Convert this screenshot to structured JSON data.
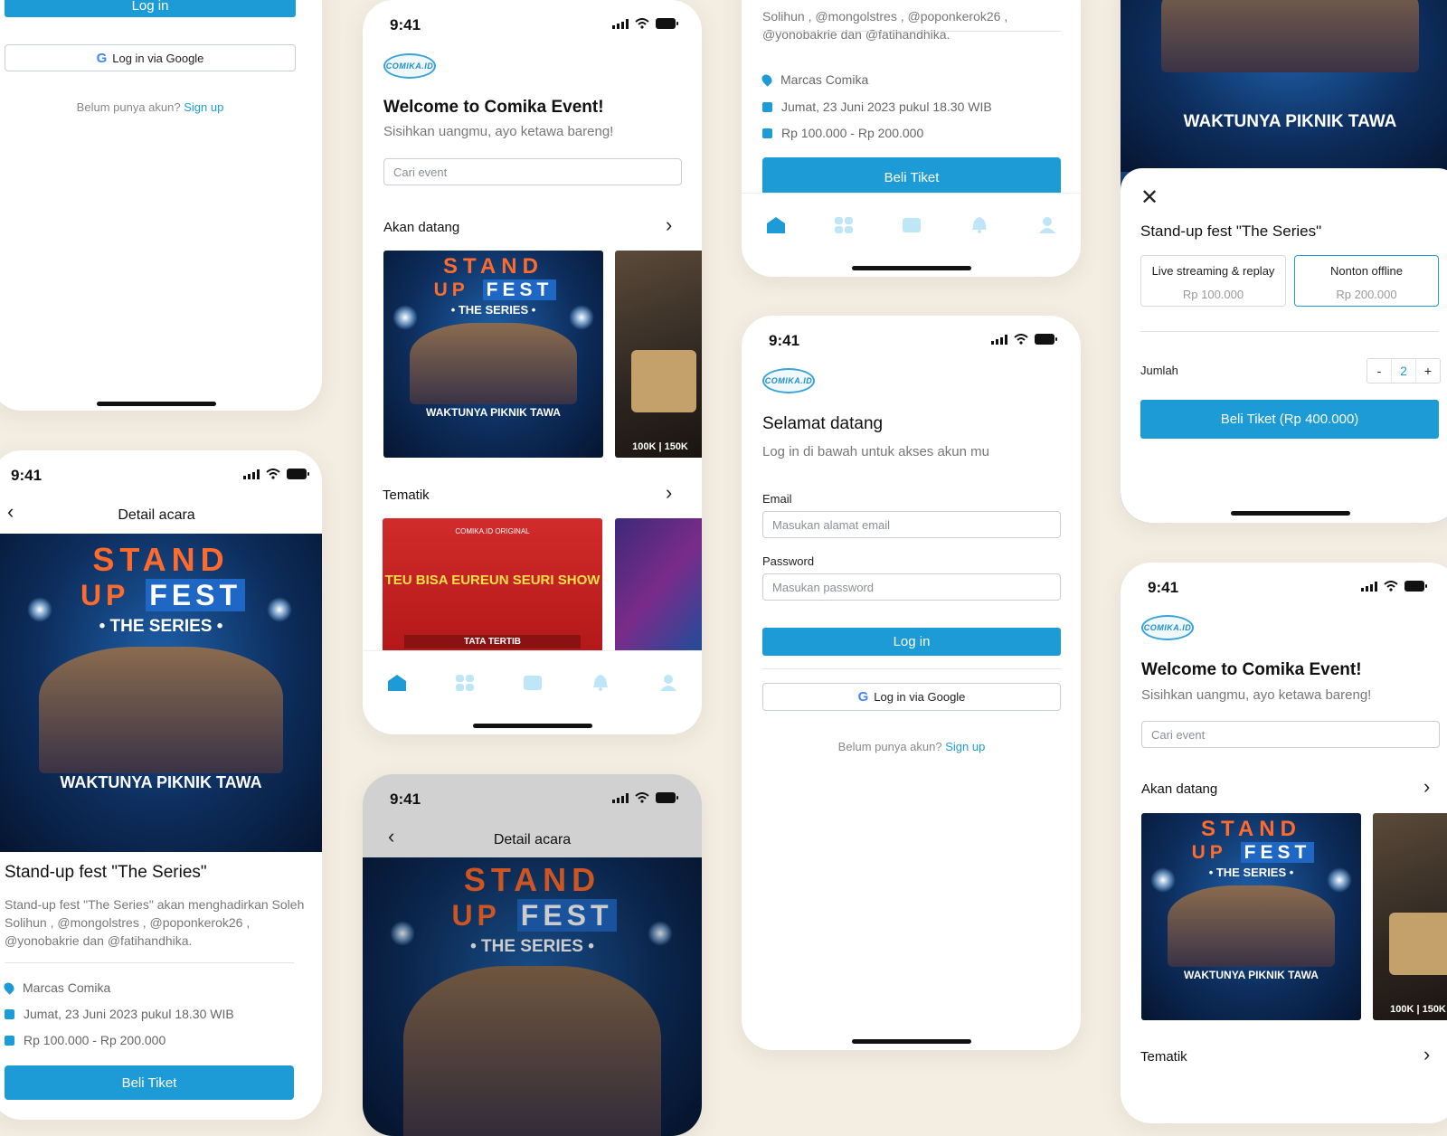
{
  "status": {
    "time": "9:41"
  },
  "login": {
    "welcome_title": "Selamat datang",
    "welcome_sub": "Log in di bawah untuk akses akun mu",
    "email_label": "Email",
    "email_placeholder": "Masukan alamat email",
    "password_label": "Password",
    "password_placeholder": "Masukan password",
    "login_button": "Log in",
    "google_button": "Log in via Google",
    "no_account": "Belum punya akun?",
    "signup_link": "Sign up"
  },
  "home": {
    "logo_text": "COMIKA.ID",
    "title": "Welcome to Comika Event!",
    "subtitle": "Sisihkan uangmu, ayo ketawa bareng!",
    "search_placeholder": "Cari event",
    "section_upcoming": "Akan datang",
    "section_thematic": "Tematik"
  },
  "poster": {
    "line1": "STAND",
    "up": "UP",
    "fest": "FEST",
    "series": "• THE SERIES •",
    "tagline": "WAKTUNYA PIKNIK TAWA",
    "price_badge": "100K | 150K",
    "thematic_title": "TEU BISA EUREUN SEURI SHOW",
    "thematic_sub": "TATA TERTIB",
    "thematic_top": "COMIKA.ID ORIGINAL"
  },
  "detail": {
    "nav_title": "Detail acara",
    "event_title": "Stand-up fest \"The Series\"",
    "description": "Stand-up fest \"The Series\" akan menghadirkan Soleh Solihun , @mongolstres , @poponkerok26 , @yonobakrie dan @fatihandhika.",
    "description_tail": "Solihun , @mongolstres , @poponkerok26 , @yonobakrie dan @fatihandhika.",
    "venue": "Marcas Comika",
    "datetime": "Jumat, 23 Juni 2023 pukul 18.30 WIB",
    "price_range": "Rp 100.000 - Rp 200.000",
    "buy_button": "Beli Tiket"
  },
  "purchase": {
    "title": "Stand-up fest \"The Series\"",
    "options": [
      {
        "name": "Live streaming & replay",
        "price": "Rp 100.000"
      },
      {
        "name": "Nonton offline",
        "price": "Rp 200.000"
      }
    ],
    "qty_label": "Jumlah",
    "qty_minus": "-",
    "qty_value": "2",
    "qty_plus": "+",
    "buy_button": "Beli Tiket (Rp 400.000)"
  },
  "colors": {
    "accent": "#1d9bd7",
    "background": "#f3ede2"
  },
  "tabs": [
    "home-icon",
    "grid-icon",
    "ticket-icon",
    "bell-icon",
    "profile-icon"
  ]
}
